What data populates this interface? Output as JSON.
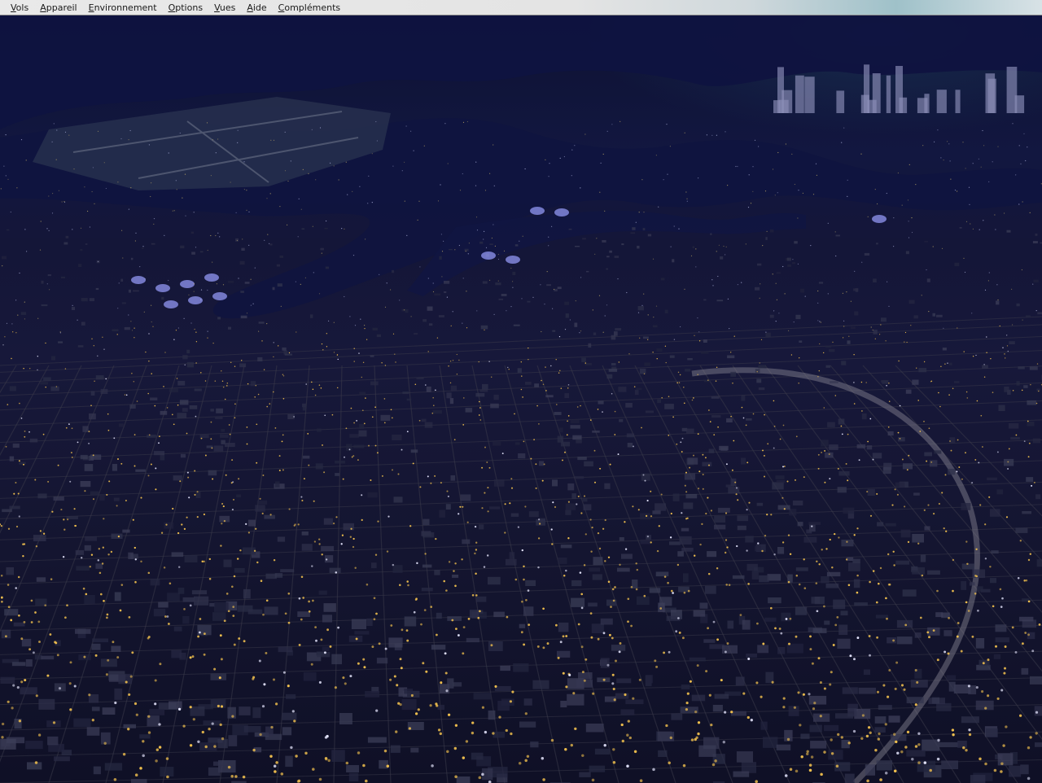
{
  "menu": {
    "items": [
      {
        "id": "vols",
        "label": "Vols",
        "mnemonic": "V",
        "rest": "ols"
      },
      {
        "id": "appareil",
        "label": "Appareil",
        "mnemonic": "A",
        "rest": "ppareil"
      },
      {
        "id": "environnement",
        "label": "Environnement",
        "mnemonic": "E",
        "rest": "nvironnement"
      },
      {
        "id": "options",
        "label": "Options",
        "mnemonic": "O",
        "rest": "ptions"
      },
      {
        "id": "vues",
        "label": "Vues",
        "mnemonic": "V",
        "rest": "ues"
      },
      {
        "id": "aide",
        "label": "Aide",
        "mnemonic": "A",
        "rest": "ide"
      },
      {
        "id": "complements",
        "label": "Compléments",
        "mnemonic": "C",
        "rest": "ompléments"
      }
    ]
  },
  "scene": {
    "description_colors": {
      "water": "#0f1340",
      "land_dark": "#16173a",
      "street_light": "#f2c14e",
      "tank_glow": "#9aa0ff",
      "menubar_bg": "#e6e6e6",
      "menubar_text": "#1a1a1a"
    }
  }
}
